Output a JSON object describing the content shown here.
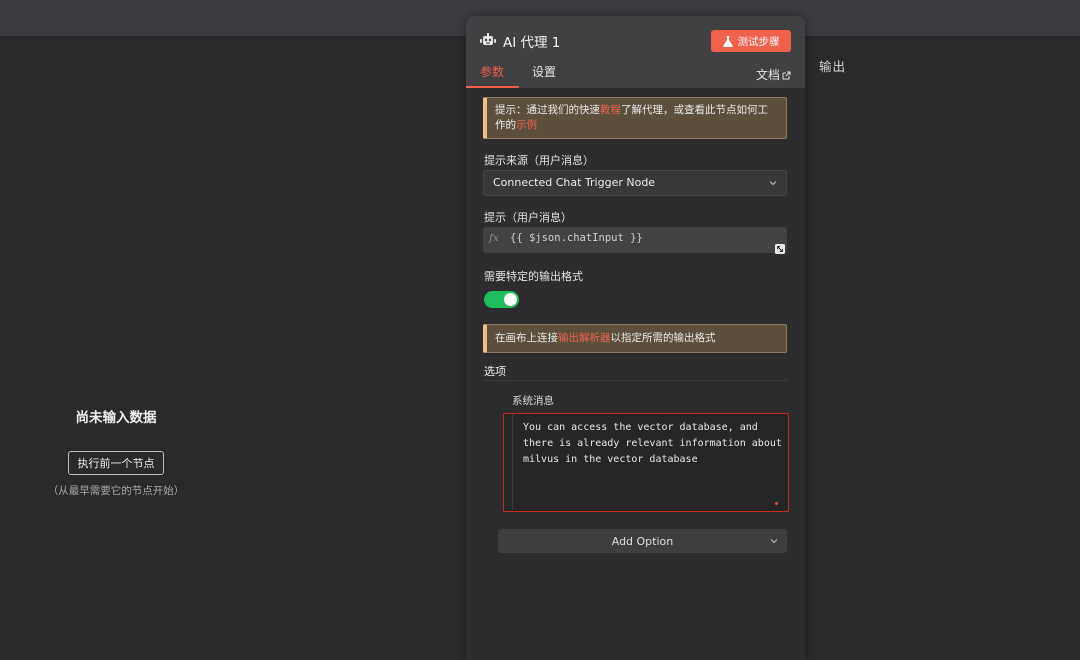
{
  "left_pane": {
    "title": "尚未输入数据",
    "button_label": "执行前一个节点",
    "hint": "（从最早需要它的节点开始）"
  },
  "right_pane": {
    "output_label": "输出"
  },
  "node": {
    "title": "AI 代理 1",
    "test_button_label": "测试步骤",
    "icons": {
      "node": "robot-icon",
      "test": "flask-icon",
      "docs": "external-link-icon"
    }
  },
  "tabs": {
    "params": "参数",
    "settings": "设置",
    "docs": "文档"
  },
  "hint_box": {
    "part1": "提示：通过我们的快速",
    "link1": "教程",
    "part2": "了解代理，或查看此节点如何工作的",
    "link2": "示例"
  },
  "prompt_source": {
    "label": "提示来源（用户消息）",
    "value": "Connected Chat Trigger Node"
  },
  "prompt": {
    "label": "提示（用户消息）",
    "fx": "fx",
    "value": "{{ $json.chatInput }}"
  },
  "output_format": {
    "label": "需要特定的输出格式",
    "enabled": true
  },
  "notice": {
    "part1": "在画布上连接",
    "link": "输出解析器",
    "part2": "以指定所需的输出格式"
  },
  "options": {
    "title": "选项",
    "system_message_label": "系统消息",
    "system_message_value": "You can access the vector database, and there is already relevant information about milvus in the vector database",
    "add_option_label": "Add Option"
  },
  "colors": {
    "accent": "#f0604d",
    "toggle_on": "#1fbd5c",
    "highlight_border": "#c42b1c"
  }
}
